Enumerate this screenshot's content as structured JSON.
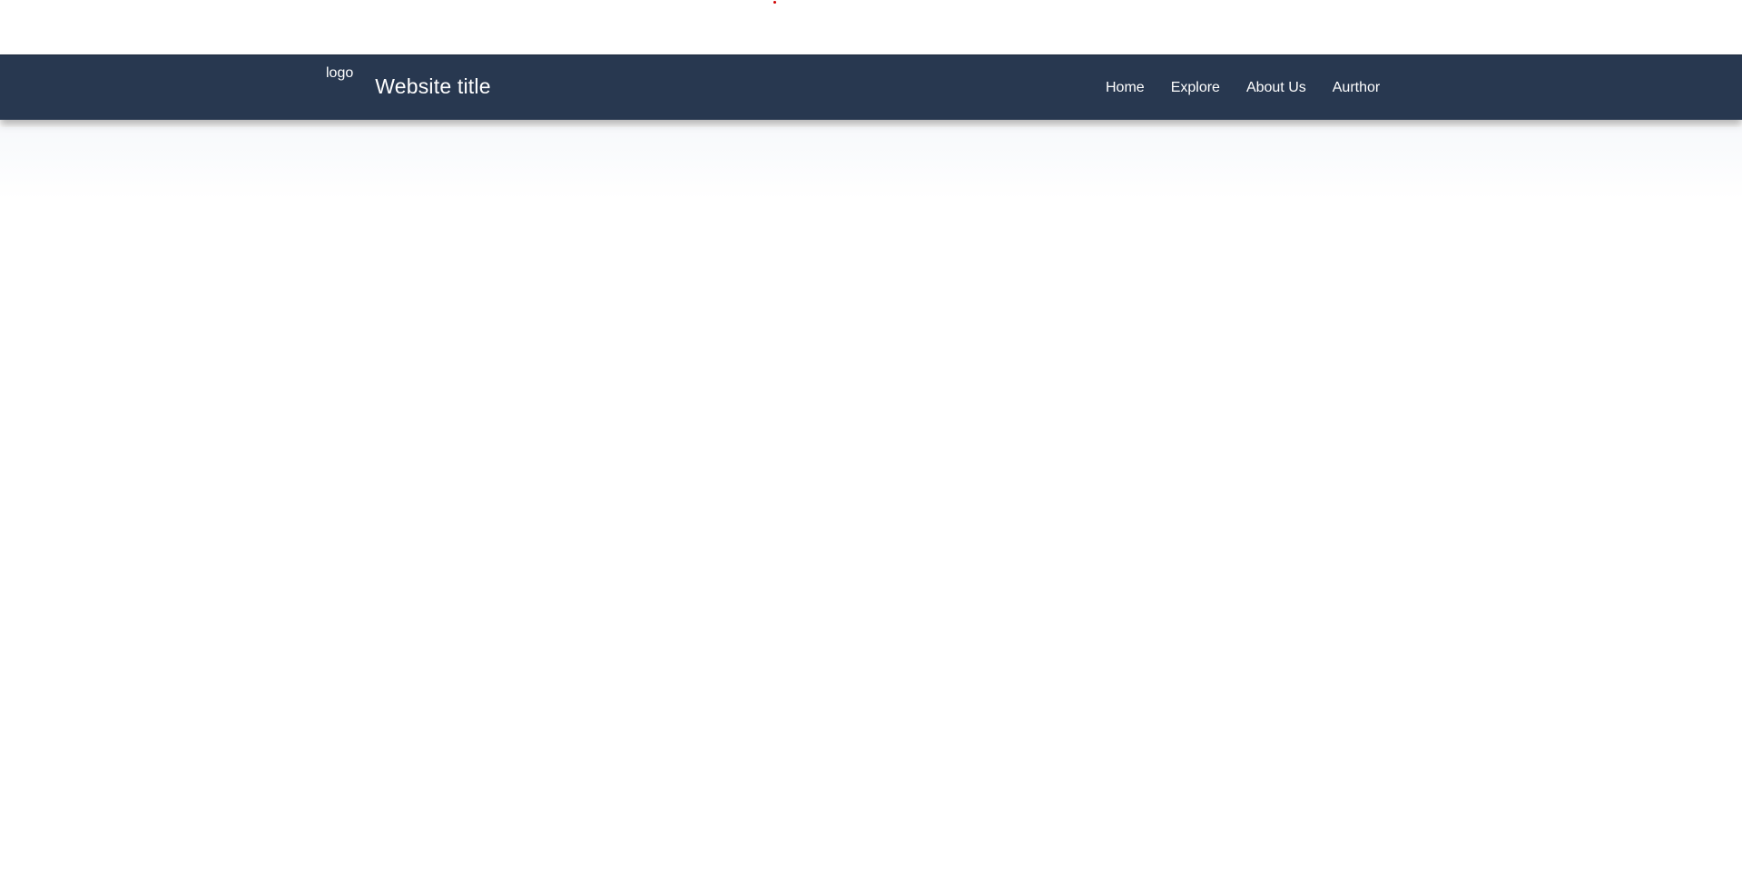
{
  "header": {
    "logo_alt": "logo",
    "title": "Website title"
  },
  "nav": {
    "items": [
      {
        "label": "Home"
      },
      {
        "label": "Explore"
      },
      {
        "label": "About Us"
      },
      {
        "label": "Aurthor"
      }
    ]
  },
  "colors": {
    "navbar_bg": "#283850",
    "nav_text": "#ffffff",
    "page_bg": "#ffffff"
  }
}
